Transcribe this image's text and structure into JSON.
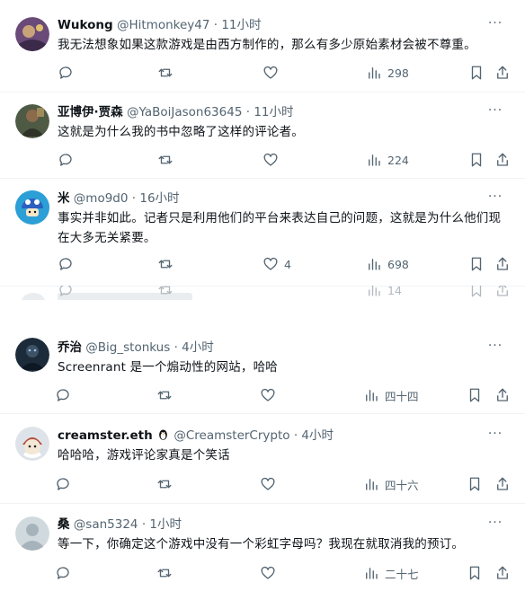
{
  "more_label": "···",
  "tweets_top": [
    {
      "name": "Wukong",
      "handle": "@Hitmonkey47",
      "dot": "·",
      "time": "11小时",
      "text": "我无法想象如果这款游戏是由西方制作的，那么有多少原始素材会被不尊重。",
      "views": "298",
      "likes": ""
    },
    {
      "name": "亚博伊·贾森",
      "handle": "@YaBoiJason63645",
      "dot": "·",
      "time": "11小时",
      "text": "这就是为什么我的书中忽略了这样的评论者。",
      "views": "224",
      "likes": ""
    },
    {
      "name": "米",
      "handle": "@mo9d0",
      "dot": "·",
      "time": "16小时",
      "text": "事实并非如此。记者只是利用他们的平台来表达自己的问题，这就是为什么他们现在大多无关紧要。",
      "views": "698",
      "likes": "4"
    }
  ],
  "seam": {
    "views": "14"
  },
  "tweets_bottom": [
    {
      "name": "乔治",
      "handle": "@Big_stonkus",
      "dot": "·",
      "time": "4小时",
      "text": "Screenrant 是一个煽动性的网站，哈哈",
      "views": "四十四",
      "likes": ""
    },
    {
      "name": "creamster.eth",
      "handle": "@CreamsterCrypto",
      "dot": "·",
      "time": "4小时",
      "text": "哈哈哈，游戏评论家真是个笑话",
      "views": "四十六",
      "likes": ""
    },
    {
      "name": "桑",
      "handle": "@san5324",
      "dot": "·",
      "time": "1小时",
      "text": "等一下，你确定这个游戏中没有一个彩虹字母吗？我现在就取消我的预订。",
      "views": "二十七",
      "likes": ""
    }
  ],
  "colors": {
    "text": "#0f1419",
    "muted": "#536471",
    "divider": "#eff3f4"
  }
}
